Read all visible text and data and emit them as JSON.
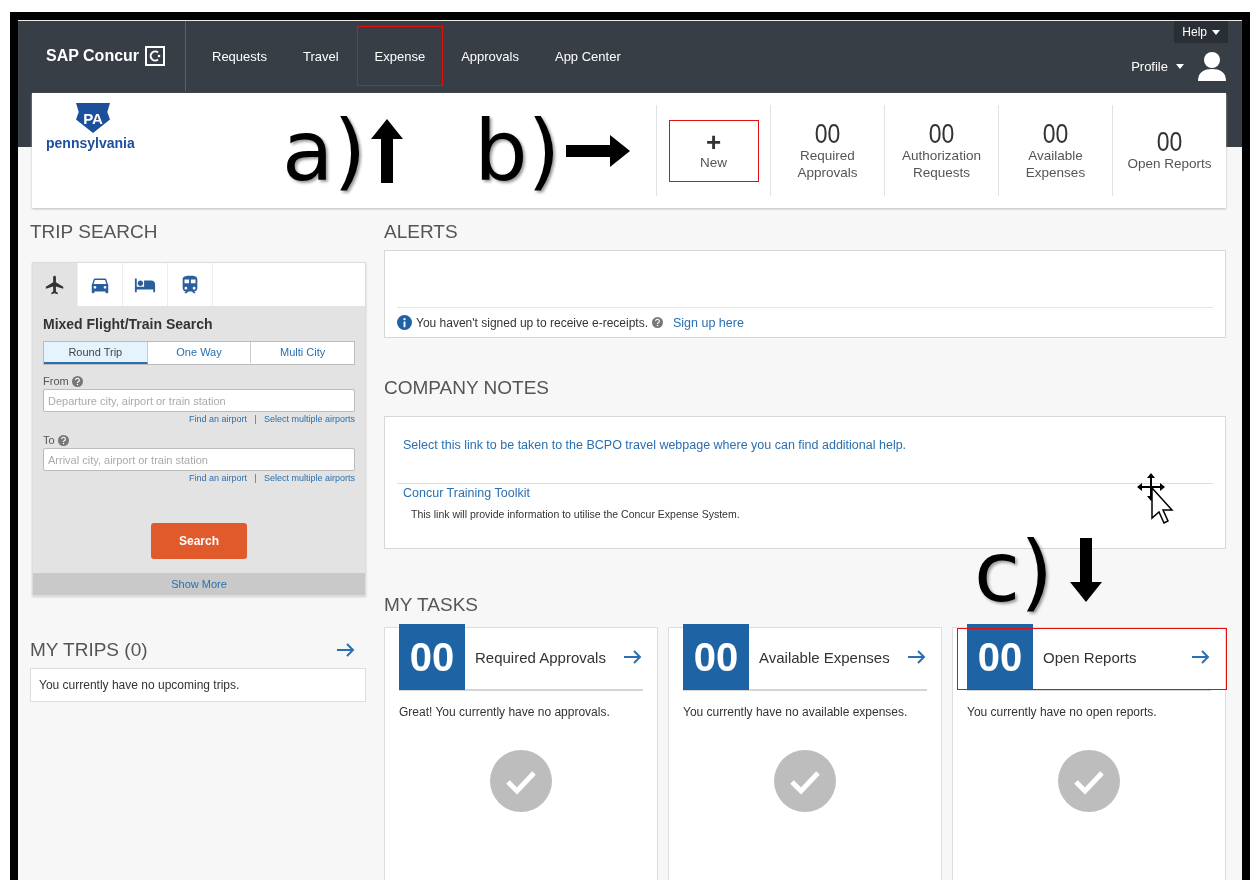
{
  "brand": {
    "name": "SAP Concur"
  },
  "nav": [
    {
      "label": "Requests",
      "highlighted": false
    },
    {
      "label": "Travel",
      "highlighted": false
    },
    {
      "label": "Expense",
      "highlighted": true
    },
    {
      "label": "Approvals",
      "highlighted": false
    },
    {
      "label": "App Center",
      "highlighted": false
    }
  ],
  "help": "Help",
  "profile": "Profile",
  "logo": {
    "badge": "PA",
    "name": "pennsylvania"
  },
  "annotations": [
    {
      "label": "a)",
      "kind": "up"
    },
    {
      "label": "b)",
      "kind": "right"
    },
    {
      "label": "c)",
      "kind": "down"
    }
  ],
  "quick_actions": [
    {
      "kind": "new",
      "symbol": "+",
      "label": "New",
      "highlighted": true
    },
    {
      "kind": "count",
      "count": "00",
      "label": "Required Approvals",
      "highlighted": false
    },
    {
      "kind": "count",
      "count": "00",
      "label": "Authorization Requests",
      "highlighted": false
    },
    {
      "kind": "count",
      "count": "00",
      "label": "Available Expenses",
      "highlighted": false
    },
    {
      "kind": "count",
      "count": "00",
      "label": "Open Reports",
      "highlighted": false
    }
  ],
  "trip_search": {
    "title": "TRIP SEARCH",
    "tabs": [
      {
        "kind": "flight-train",
        "selected": true
      },
      {
        "kind": "car",
        "selected": false
      },
      {
        "kind": "hotel",
        "selected": false
      },
      {
        "kind": "rail",
        "selected": false
      }
    ],
    "heading": "Mixed Flight/Train Search",
    "trip_types": [
      {
        "label": "Round Trip",
        "selected": true
      },
      {
        "label": "One Way",
        "selected": false
      },
      {
        "label": "Multi City",
        "selected": false
      }
    ],
    "fields": [
      {
        "label": "From",
        "placeholder": "Departure city, airport or train station",
        "links": [
          "Find an airport",
          "Select multiple airports"
        ]
      },
      {
        "label": "To",
        "placeholder": "Arrival city, airport or train station",
        "links": [
          "Find an airport",
          "Select multiple airports"
        ]
      }
    ],
    "button": "Search",
    "show_more": "Show More"
  },
  "my_trips": {
    "title": "MY TRIPS (0)",
    "message": "You currently have no upcoming trips."
  },
  "alerts": {
    "title": "ALERTS",
    "message": "You haven't signed up to receive e-receipts.",
    "link": "Sign up here"
  },
  "company_notes": {
    "title": "COMPANY NOTES",
    "notes": [
      {
        "link": "Select this link to be taken to the BCPO travel webpage where you can find additional help."
      },
      {
        "link": "Concur Training Toolkit",
        "description": "This link will provide information to utilise the Concur Expense System."
      }
    ]
  },
  "my_tasks": {
    "title": "MY TASKS",
    "cards": [
      {
        "count": "00",
        "title": "Required Approvals",
        "message": "Great! You currently have no approvals.",
        "highlighted": false
      },
      {
        "count": "00",
        "title": "Available Expenses",
        "message": "You currently have no available expenses.",
        "highlighted": false
      },
      {
        "count": "00",
        "title": "Open Reports",
        "message": "You currently have no open reports.",
        "highlighted": true
      }
    ]
  }
}
